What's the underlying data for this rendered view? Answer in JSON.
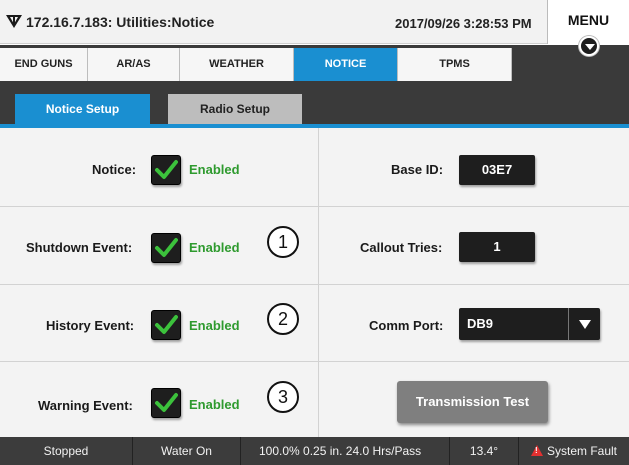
{
  "header": {
    "title": "172.16.7.183: Utilities:Notice",
    "datetime": "2017/09/26 3:28:53 PM",
    "menu_label": "MENU"
  },
  "tabs": [
    {
      "label": "END GUNS",
      "active": false
    },
    {
      "label": "AR/AS",
      "active": false
    },
    {
      "label": "WEATHER",
      "active": false
    },
    {
      "label": "NOTICE",
      "active": true
    },
    {
      "label": "TPMS",
      "active": false
    }
  ],
  "subtabs": [
    {
      "label": "Notice Setup",
      "active": true
    },
    {
      "label": "Radio Setup",
      "active": false
    }
  ],
  "notice_setup": {
    "notice": {
      "label": "Notice:",
      "checked": true,
      "status": "Enabled"
    },
    "shutdown": {
      "label": "Shutdown Event:",
      "checked": true,
      "status": "Enabled",
      "marker": "1"
    },
    "history": {
      "label": "History Event:",
      "checked": true,
      "status": "Enabled",
      "marker": "2"
    },
    "warning": {
      "label": "Warning Event:",
      "checked": true,
      "status": "Enabled",
      "marker": "3"
    }
  },
  "radio": {
    "base_id": {
      "label": "Base ID:",
      "value": "03E7"
    },
    "callout_tries": {
      "label": "Callout Tries:",
      "value": "1"
    },
    "comm_port": {
      "label": "Comm Port:",
      "value": "DB9"
    },
    "transmission_test_label": "Transmission Test"
  },
  "status_bar": {
    "state": "Stopped",
    "water": "Water On",
    "percent": "100.0%",
    "depth": "0.25 in.",
    "hrs_pass": "24.0 Hrs/Pass",
    "angle": "13.4°",
    "fault": "System Fault"
  },
  "colors": {
    "accent": "#1a8fd1",
    "enabled_text": "#2e9a2e",
    "fault_icon": "#e23030",
    "dark_bar": "#3a3a3a"
  }
}
